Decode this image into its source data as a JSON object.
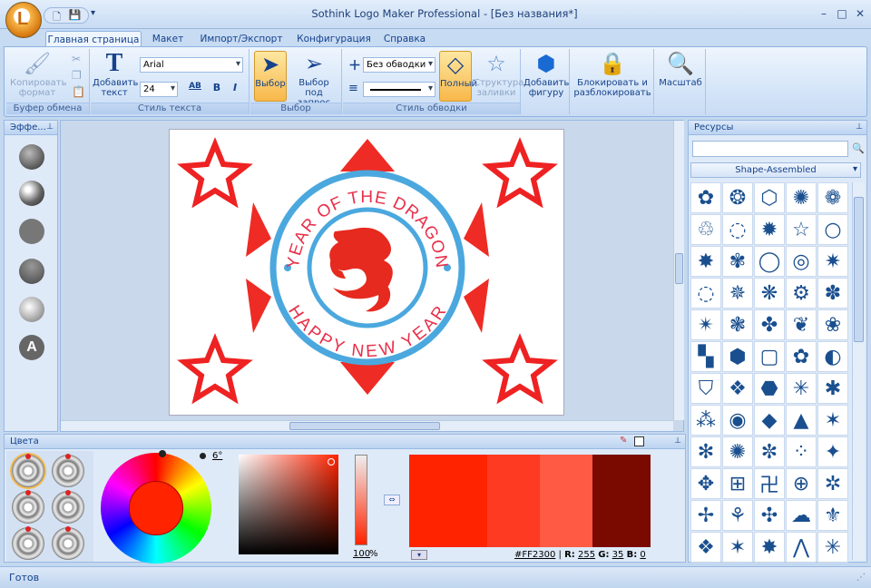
{
  "window": {
    "title": "Sothink Logo Maker Professional - [Без названия*]",
    "min": "–",
    "max": "□",
    "close": "✕",
    "qat_more": "▾"
  },
  "tabs": [
    "Главная страница",
    "Макет",
    "Импорт/Экспорт",
    "Конфигурация",
    "Справка"
  ],
  "ribbon": {
    "clipboard": {
      "group": "Буфер обмена",
      "copy_format": "Копировать формат"
    },
    "text": {
      "group": "Стиль текста",
      "add_text": "Добавить текст",
      "font": "Arial",
      "size": "24",
      "bold": "B",
      "italic": "I",
      "spacing": "AB"
    },
    "select": {
      "group": "Выбор",
      "select": "Выбор",
      "select_sub": "Выбор под запрос"
    },
    "stroke": {
      "group": "Стиль обводки",
      "border": "Без обводки",
      "full": "Полный",
      "fill_struct": "Структура заливки"
    },
    "add_shape": "Добавить фигуру",
    "lock": "Блокировать и разблокировать",
    "zoom": "Масштаб"
  },
  "effects": {
    "title": "Эффе..."
  },
  "resources": {
    "title": "Ресурсы",
    "category": "Shape-Assembled",
    "search_placeholder": ""
  },
  "logo": {
    "top_text": "YEAR OF THE DRAGON",
    "bottom_text": "HAPPY NEW YEAR"
  },
  "colors": {
    "title": "Цвета",
    "hex": "#FF2300",
    "r_label": "R:",
    "r": "255",
    "g_label": "G:",
    "g": "35",
    "b_label": "B:",
    "b": "0",
    "angle": "6°",
    "opacity": "100",
    "opacity_unit": "%",
    "swatches": [
      "#ff2300",
      "#ff3a22",
      "#ff5a44",
      "#7a0a00"
    ]
  },
  "status": "Готов"
}
